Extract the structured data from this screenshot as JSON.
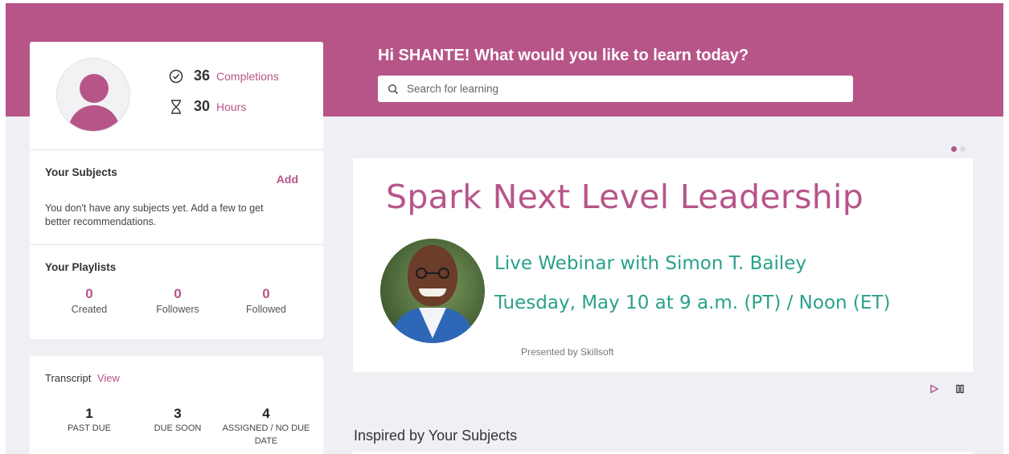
{
  "profile": {
    "completions_count": "36",
    "completions_label": "Completions",
    "hours_count": "30",
    "hours_label": "Hours"
  },
  "subjects": {
    "title": "Your Subjects",
    "add_label": "Add",
    "empty_message": "You don't have any subjects yet. Add a few to get better recommendations."
  },
  "playlists": {
    "title": "Your Playlists",
    "items": [
      {
        "count": "0",
        "label": "Created"
      },
      {
        "count": "0",
        "label": "Followers"
      },
      {
        "count": "0",
        "label": "Followed"
      }
    ]
  },
  "transcript": {
    "title": "Transcript",
    "view_label": "View",
    "items": [
      {
        "count": "1",
        "label": "PAST DUE"
      },
      {
        "count": "3",
        "label": "DUE SOON"
      },
      {
        "count": "4",
        "label": "ASSIGNED / NO DUE DATE"
      }
    ]
  },
  "header": {
    "greeting": "Hi SHANTE! What would you like to learn today?",
    "search_placeholder": "Search for learning"
  },
  "carousel": {
    "active_index": 0,
    "slide_count": 2,
    "title": "Spark Next Level Leadership",
    "line1": "Live Webinar with Simon T. Bailey",
    "line2": "Tuesday, May 10 at 9 a.m. (PT) / Noon (ET)",
    "credit": "Presented by Skillsoft"
  },
  "sections": {
    "inspired_title": "Inspired by Your Subjects"
  },
  "colors": {
    "accent": "#b75589",
    "banner": "#b75589",
    "promo_text": "#2aa18a",
    "page_bg": "#eef0f4"
  },
  "icons": {
    "completions": "check-circle-icon",
    "hours": "hourglass-icon",
    "search": "search-icon",
    "play": "play-icon",
    "pause": "pause-icon"
  }
}
